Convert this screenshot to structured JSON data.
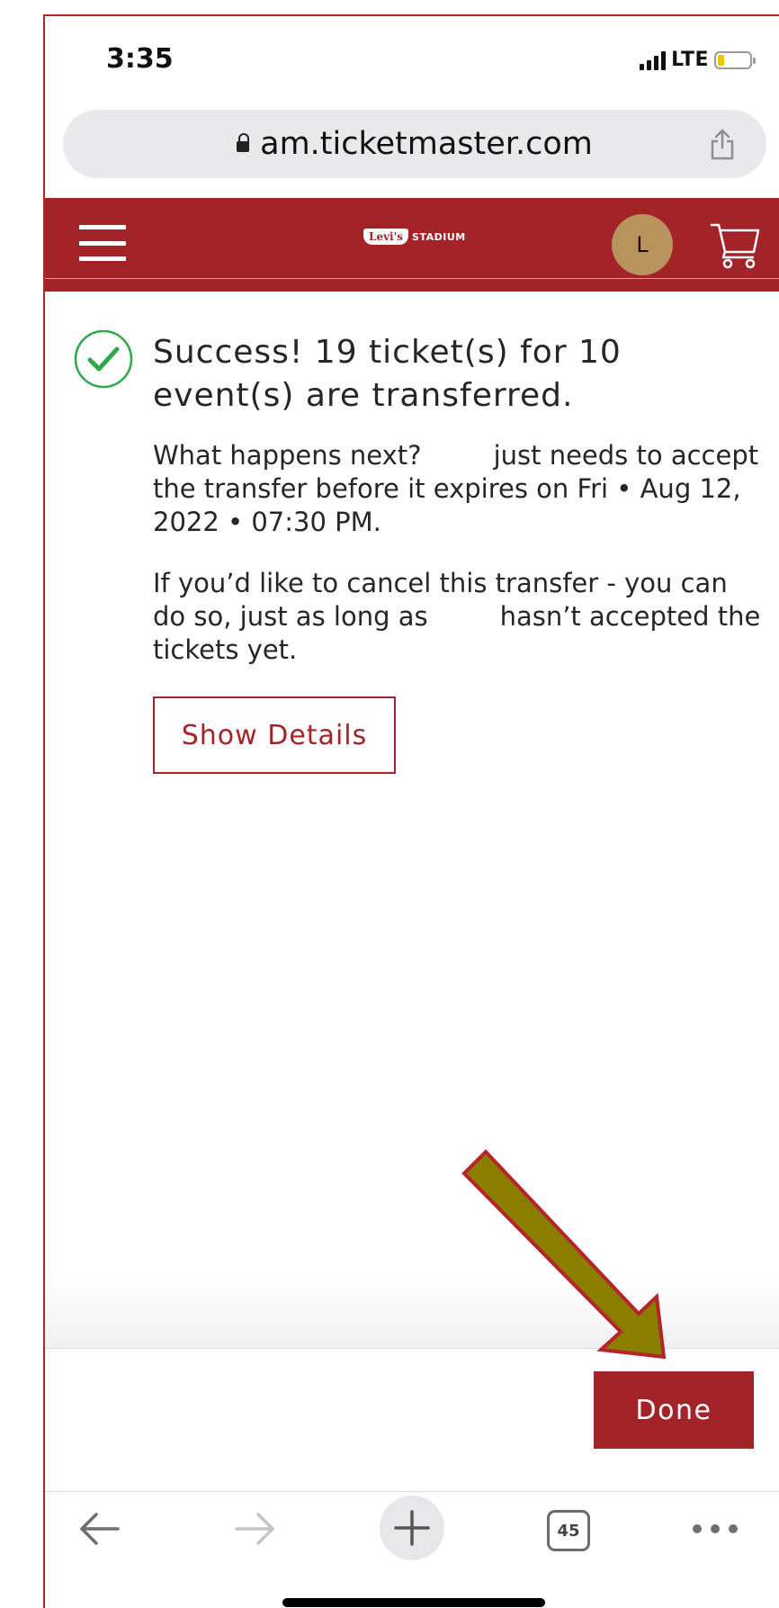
{
  "status_bar": {
    "time": "3:35",
    "network": "LTE",
    "battery_level_pct": 20,
    "battery_color": "#f3c300"
  },
  "browser": {
    "url": "am.ticketmaster.com",
    "tabs_count": "45",
    "icons": [
      "lock-icon",
      "share-icon",
      "back-arrow-icon",
      "forward-arrow-icon",
      "plus-icon",
      "tabs-icon",
      "more-icon"
    ]
  },
  "header": {
    "logo_brand": "Levi's",
    "logo_suffix": "STADIUM",
    "avatar_initial": "L",
    "brand_color": "#a32428",
    "icons": [
      "menu-icon",
      "cart-icon"
    ]
  },
  "main": {
    "title": "Success! 19 ticket(s) for 10 event(s) are transferred.",
    "paragraph1": {
      "part1": "What happens next?",
      "part2": "just needs to accept the transfer before it expires on Fri • Aug 12, 2022 • 07:30 PM."
    },
    "paragraph2": {
      "part1": "If you’d like to cancel this transfer - you can do so, just as long as",
      "part2": "hasn’t accepted the tickets yet."
    },
    "show_details_label": "Show Details",
    "success_color": "#2ea84a"
  },
  "footer": {
    "done_label": "Done"
  },
  "annotation": {
    "arrow_fill": "#8a7d00",
    "arrow_stroke": "#b5232b"
  }
}
